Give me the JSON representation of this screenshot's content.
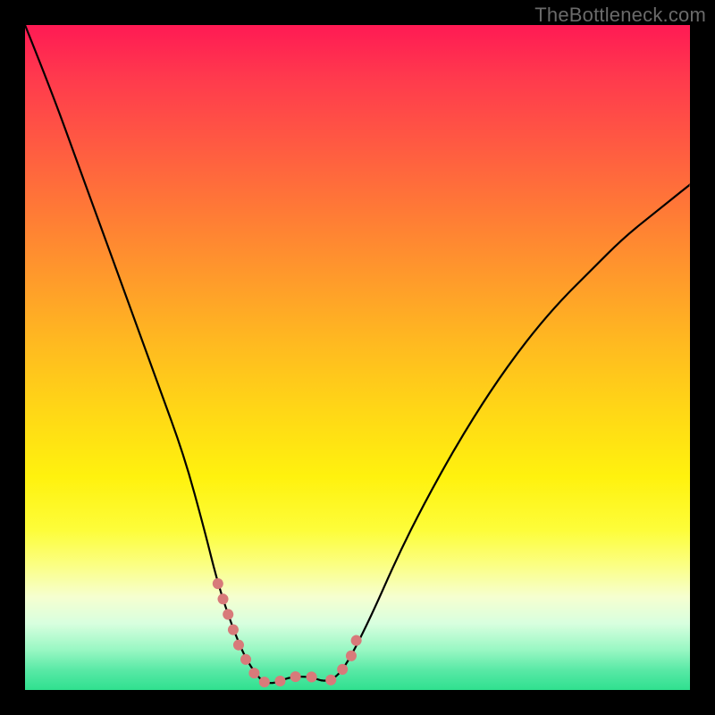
{
  "watermark": "TheBottleneck.com",
  "colors": {
    "background": "#000000",
    "curve_stroke": "#000000",
    "highlight_stroke": "#d87a7a",
    "gradient_top": "#ff1a54",
    "gradient_bottom": "#2fe08f"
  },
  "chart_data": {
    "type": "line",
    "title": "",
    "xlabel": "",
    "ylabel": "",
    "xlim": [
      0,
      100
    ],
    "ylim": [
      0,
      100
    ],
    "grid": false,
    "legend": false,
    "series": [
      {
        "name": "bottleneck-curve",
        "x": [
          0,
          4,
          8,
          12,
          16,
          20,
          24,
          27,
          29,
          31,
          33,
          35,
          36,
          37,
          38,
          40,
          43,
          45,
          47,
          49,
          52,
          56,
          60,
          65,
          70,
          75,
          80,
          85,
          90,
          95,
          100
        ],
        "values": [
          100,
          90,
          79,
          68,
          57,
          46,
          35,
          24,
          16,
          10,
          5,
          2,
          1.2,
          1.0,
          1.2,
          2,
          2,
          1.2,
          2,
          5,
          11,
          20,
          28,
          37,
          45,
          52,
          58,
          63,
          68,
          72,
          76
        ]
      }
    ],
    "highlight_segments": [
      {
        "name": "left-descent-dots",
        "x": [
          29,
          30,
          31,
          32,
          33,
          34,
          35
        ],
        "values": [
          16,
          13,
          10,
          7,
          5,
          3,
          2
        ]
      },
      {
        "name": "valley-floor-dots",
        "x": [
          36,
          37,
          38,
          40,
          42,
          43,
          44,
          45
        ],
        "values": [
          1.2,
          1.0,
          1.2,
          2,
          2,
          2,
          1.5,
          1.2
        ]
      },
      {
        "name": "right-ascent-dots",
        "x": [
          46,
          47,
          48,
          49,
          50
        ],
        "values": [
          1.5,
          2,
          3.5,
          5,
          8
        ]
      }
    ]
  }
}
